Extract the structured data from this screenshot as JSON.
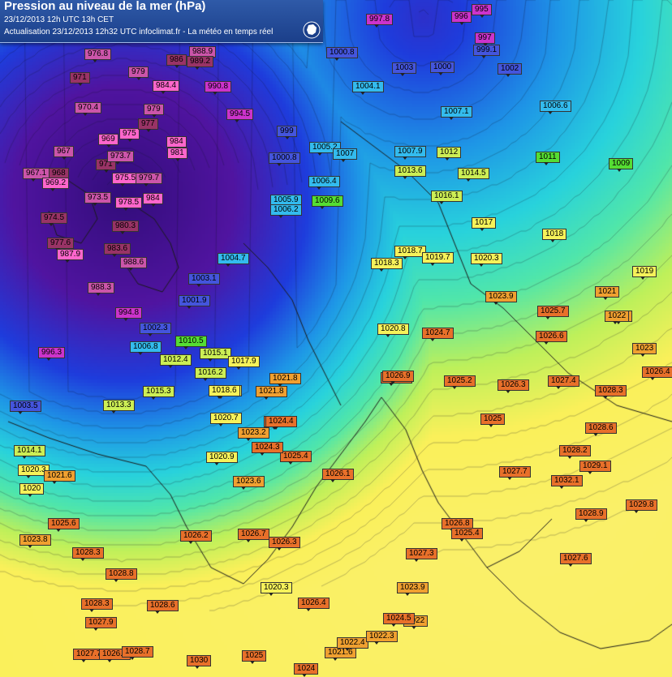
{
  "header": {
    "title": "Pression au niveau de la mer (hPa)",
    "subtitle": "23/12/2013  12h UTC  13h CET",
    "update": "Actualisation 23/12/2013 12h32 UTC   infoclimat.fr - La météo en temps réel"
  },
  "colors": {
    "low_deep": "#2a0a6e",
    "low": "#1a40d0",
    "mid": "#2bd8c8",
    "high": "#f4f060",
    "very_high": "#e8702a",
    "label_text": "#000000"
  },
  "pressure_labels": [
    {
      "v": "976.8"
    },
    {
      "v": "971"
    },
    {
      "v": "970.4"
    },
    {
      "v": "969"
    },
    {
      "v": "967"
    },
    {
      "v": "967.1"
    },
    {
      "v": "968"
    },
    {
      "v": "969.2"
    },
    {
      "v": "971"
    },
    {
      "v": "973.7"
    },
    {
      "v": "975"
    },
    {
      "v": "977"
    },
    {
      "v": "975.5"
    },
    {
      "v": "979.7"
    },
    {
      "v": "973.5"
    },
    {
      "v": "978.5"
    },
    {
      "v": "974.5"
    },
    {
      "v": "980.3"
    },
    {
      "v": "977.6"
    },
    {
      "v": "983.6"
    },
    {
      "v": "987.9"
    },
    {
      "v": "988.6"
    },
    {
      "v": "988.3"
    },
    {
      "v": "979"
    },
    {
      "v": "984.4"
    },
    {
      "v": "979"
    },
    {
      "v": "984"
    },
    {
      "v": "981"
    },
    {
      "v": "984"
    },
    {
      "v": "986"
    },
    {
      "v": "988.9"
    },
    {
      "v": "989.2"
    },
    {
      "v": "990.8"
    },
    {
      "v": "994.5"
    },
    {
      "v": "999"
    },
    {
      "v": "1000.8"
    },
    {
      "v": "1005.2"
    },
    {
      "v": "1007"
    },
    {
      "v": "1006.4"
    },
    {
      "v": "1009.6"
    },
    {
      "v": "1005.9"
    },
    {
      "v": "1006.2"
    },
    {
      "v": "1004.7"
    },
    {
      "v": "1003.1"
    },
    {
      "v": "1001.9"
    },
    {
      "v": "994.8"
    },
    {
      "v": "996.3"
    },
    {
      "v": "1003.5"
    },
    {
      "v": "1002.3"
    },
    {
      "v": "1006.8"
    },
    {
      "v": "1010.5"
    },
    {
      "v": "1012.4"
    },
    {
      "v": "1013.3"
    },
    {
      "v": "1015.1"
    },
    {
      "v": "1015.3"
    },
    {
      "v": "1014.1"
    },
    {
      "v": "1020.3"
    },
    {
      "v": "1021.6"
    },
    {
      "v": "1020"
    },
    {
      "v": "1018.9"
    },
    {
      "v": "1020.7"
    },
    {
      "v": "1024.4"
    },
    {
      "v": "1023.6"
    },
    {
      "v": "1025.6"
    },
    {
      "v": "1023.8"
    },
    {
      "v": "1028.3"
    },
    {
      "v": "1028.8"
    },
    {
      "v": "1028.6"
    },
    {
      "v": "1028.3"
    },
    {
      "v": "1027.9"
    },
    {
      "v": "1027.7"
    },
    {
      "v": "1026.4"
    },
    {
      "v": "1028.7"
    },
    {
      "v": "1030"
    },
    {
      "v": "1025"
    },
    {
      "v": "1024"
    },
    {
      "v": "1021.6"
    },
    {
      "v": "1022.4"
    },
    {
      "v": "1022.3"
    },
    {
      "v": "1022"
    },
    {
      "v": "1023.9"
    },
    {
      "v": "1026.4"
    },
    {
      "v": "1026.3"
    },
    {
      "v": "1026.7"
    },
    {
      "v": "1026.2"
    },
    {
      "v": "1026.1"
    },
    {
      "v": "1025.4"
    },
    {
      "v": "1024.3"
    },
    {
      "v": "1023.2"
    },
    {
      "v": "1024.4"
    },
    {
      "v": "1021.8"
    },
    {
      "v": "1021.8"
    },
    {
      "v": "1020.9"
    },
    {
      "v": "1017.9"
    },
    {
      "v": "1016.2"
    },
    {
      "v": "1018.6"
    },
    {
      "v": "1018.7"
    },
    {
      "v": "1019.7"
    },
    {
      "v": "1020.3"
    },
    {
      "v": "1018.3"
    },
    {
      "v": "1020.8"
    },
    {
      "v": "1024.7"
    },
    {
      "v": "1026.9"
    },
    {
      "v": "1027.4"
    },
    {
      "v": "1025.2"
    },
    {
      "v": "1026.3"
    },
    {
      "v": "1028.3"
    },
    {
      "v": "1028.6"
    },
    {
      "v": "1028.2"
    },
    {
      "v": "1029.1"
    },
    {
      "v": "1032.1"
    },
    {
      "v": "1027.7"
    },
    {
      "v": "1029.8"
    },
    {
      "v": "1028.9"
    },
    {
      "v": "1026.4"
    },
    {
      "v": "1025.7"
    },
    {
      "v": "1026.6"
    },
    {
      "v": "1023.9"
    },
    {
      "v": "1022"
    },
    {
      "v": "1021"
    },
    {
      "v": "1019"
    },
    {
      "v": "1018"
    },
    {
      "v": "1017"
    },
    {
      "v": "1016.1"
    },
    {
      "v": "1014.5"
    },
    {
      "v": "1013.6"
    },
    {
      "v": "1012"
    },
    {
      "v": "1011"
    },
    {
      "v": "1009"
    },
    {
      "v": "1007.9"
    },
    {
      "v": "1007.1"
    },
    {
      "v": "1006.6"
    },
    {
      "v": "1004.1"
    },
    {
      "v": "1003"
    },
    {
      "v": "1000.8"
    },
    {
      "v": "1000"
    },
    {
      "v": "1002"
    },
    {
      "v": "999.1"
    },
    {
      "v": "997.8"
    },
    {
      "v": "996"
    },
    {
      "v": "995"
    },
    {
      "v": "997"
    },
    {
      "v": "1027.3"
    },
    {
      "v": "1026.8"
    },
    {
      "v": "1025.4"
    },
    {
      "v": "1024.5"
    },
    {
      "v": "1020.3"
    },
    {
      "v": "1026.9"
    },
    {
      "v": "1027.6"
    },
    {
      "v": "1025"
    },
    {
      "v": "1023"
    },
    {
      "v": "1022"
    }
  ]
}
